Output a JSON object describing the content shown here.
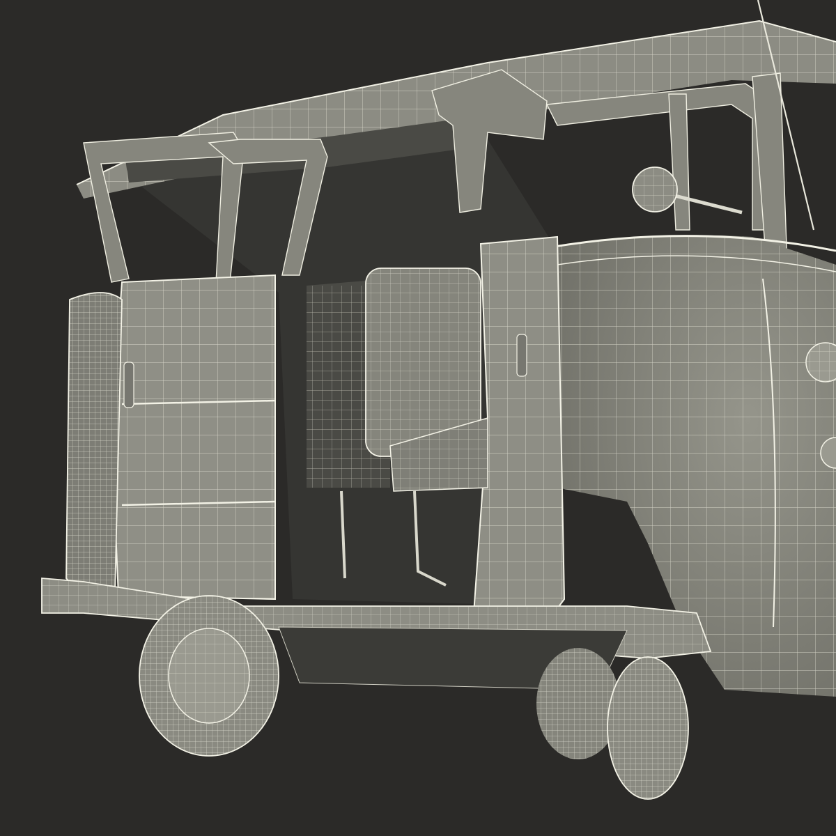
{
  "scene": {
    "subject": "wireframe-van",
    "colors": {
      "background": "#2b2a28",
      "body": "#8a8a80",
      "body_dark": "#6c6c64",
      "interior": "#3a3a36",
      "shadow": "#1f1f1d",
      "wire": "#e9e8dc"
    },
    "parts": [
      "roof",
      "window-frames",
      "rear-doors",
      "side-door",
      "seats",
      "spare-tire",
      "wheels",
      "bumper",
      "side-mirror",
      "antenna"
    ]
  }
}
